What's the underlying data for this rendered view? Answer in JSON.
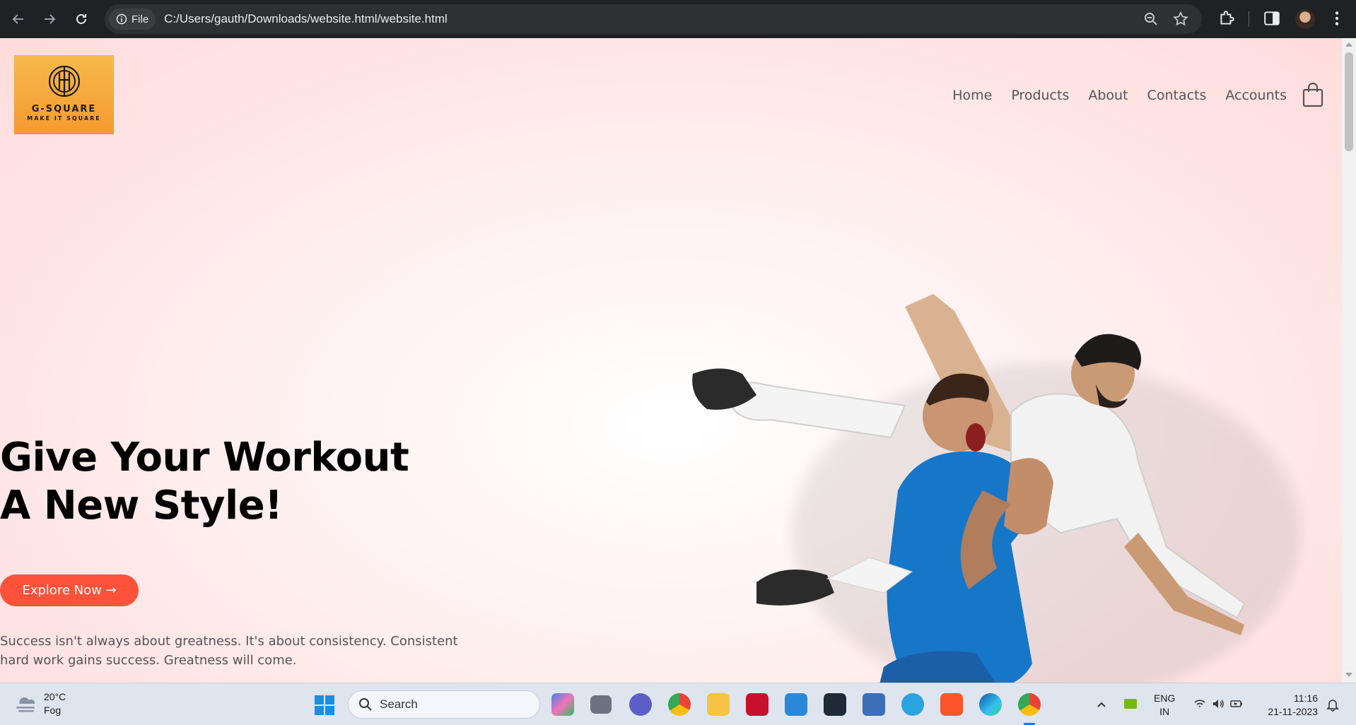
{
  "browser": {
    "file_label": "File",
    "url": "C:/Users/gauth/Downloads/website.html/website.html"
  },
  "site": {
    "logo": {
      "name": "G-SQUARE",
      "tagline": "MAKE IT SQUARE"
    },
    "nav": [
      {
        "label": "Home"
      },
      {
        "label": "Products"
      },
      {
        "label": "About"
      },
      {
        "label": "Contacts"
      },
      {
        "label": "Accounts"
      }
    ],
    "hero": {
      "title_line1": "Give Your Workout",
      "title_line2": "A New Style!",
      "cta": "Explore Now →",
      "text": "Success isn't always about greatness. It's about consistency. Consistent hard work gains success. Greatness will come."
    },
    "colors": {
      "accent": "#ff523b",
      "logo_bg": "#f5a83a"
    }
  },
  "taskbar": {
    "weather": {
      "temp": "20°C",
      "condition": "Fog"
    },
    "search_placeholder": "Search",
    "language": {
      "line1": "ENG",
      "line2": "IN"
    },
    "clock": {
      "time": "11:16",
      "date": "21-11-2023"
    }
  }
}
